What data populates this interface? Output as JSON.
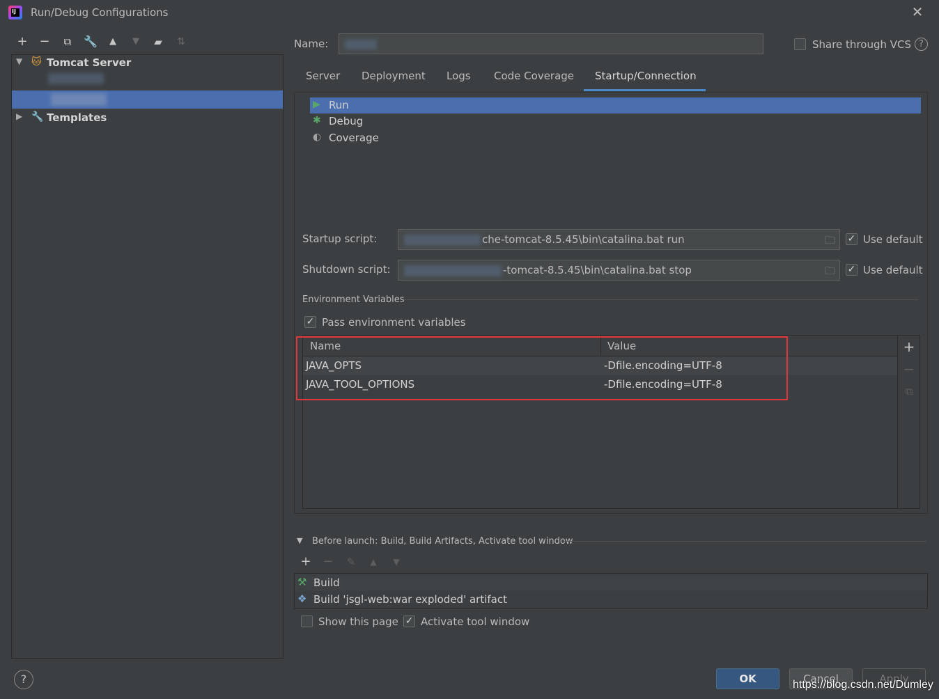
{
  "window": {
    "title": "Run/Debug Configurations"
  },
  "tree": {
    "items": [
      {
        "label": "Tomcat Server"
      },
      {
        "label": "Templates"
      }
    ]
  },
  "name_row": {
    "label": "Name:",
    "share_label": "Share through VCS",
    "share_checked": false
  },
  "tabs": [
    {
      "label": "Server"
    },
    {
      "label": "Deployment"
    },
    {
      "label": "Logs"
    },
    {
      "label": "Code Coverage"
    },
    {
      "label": "Startup/Connection",
      "active": true
    }
  ],
  "modes": [
    {
      "label": "Run",
      "icon": "run-icon",
      "selected": true
    },
    {
      "label": "Debug",
      "icon": "debug-icon"
    },
    {
      "label": "Coverage",
      "icon": "coverage-icon"
    }
  ],
  "startup": {
    "label": "Startup script:",
    "value": "che-tomcat-8.5.45\\bin\\catalina.bat run",
    "use_default_label": "Use default",
    "use_default_checked": true
  },
  "shutdown": {
    "label": "Shutdown script:",
    "value": "-tomcat-8.5.45\\bin\\catalina.bat stop",
    "use_default_label": "Use default",
    "use_default_checked": true
  },
  "env": {
    "title": "Environment Variables",
    "pass_label": "Pass environment variables",
    "pass_checked": true,
    "columns": [
      "Name",
      "Value"
    ],
    "rows": [
      {
        "name": "JAVA_OPTS",
        "value": "-Dfile.encoding=UTF-8"
      },
      {
        "name": "JAVA_TOOL_OPTIONS",
        "value": "-Dfile.encoding=UTF-8"
      }
    ]
  },
  "before_launch": {
    "title": "Before launch: Build, Build Artifacts, Activate tool window",
    "items": [
      {
        "label": "Build",
        "icon": "hammer-icon"
      },
      {
        "label": "Build 'jsgl-web:war exploded' artifact",
        "icon": "artifact-icon"
      }
    ],
    "show_page_label": "Show this page",
    "show_page_checked": false,
    "activate_label": "Activate tool window",
    "activate_checked": true
  },
  "buttons": {
    "ok": "OK",
    "cancel": "Cancel",
    "apply": "Apply",
    "help": "?"
  },
  "watermark": "https://blog.csdn.net/Dumley",
  "colors": {
    "background": "#3c3f41",
    "selection": "#4b6eaf",
    "tab_underline": "#4a88c7",
    "highlight_box": "#e3363b",
    "ok_button": "#365880"
  }
}
